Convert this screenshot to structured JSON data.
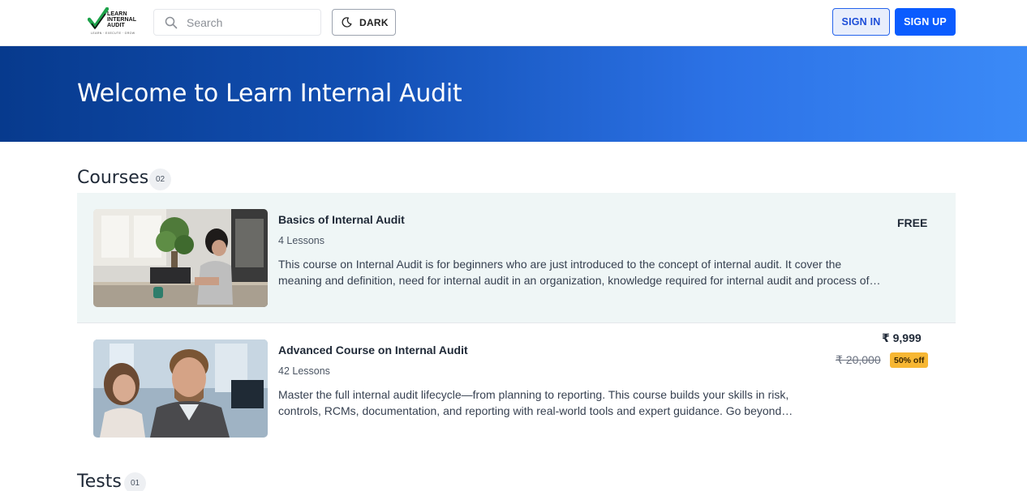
{
  "header": {
    "logo": {
      "line1": "LEARN",
      "line2": "INTERNAL",
      "line3": "AUDIT",
      "tagline": "LEARN · EXECUTE · GROW"
    },
    "search": {
      "placeholder": "Search",
      "value": ""
    },
    "theme_toggle_label": "DARK",
    "signin_label": "SIGN IN",
    "signup_label": "SIGN UP"
  },
  "hero": {
    "title": "Welcome to Learn Internal Audit"
  },
  "courses": {
    "title": "Courses",
    "count": "02",
    "items": [
      {
        "title": "Basics of Internal Audit",
        "lessons": "4 Lessons",
        "description": "This course on Internal Audit is for beginners who are just introduced to the concept of internal audit. It cover the meaning and definition, need for internal audit in an organization, knowledge required for internal audit and process of…",
        "price": "FREE"
      },
      {
        "title": "Advanced Course on Internal Audit",
        "lessons": "42 Lessons",
        "description": "Master the full internal audit lifecycle—from planning to reporting. This course builds your skills in risk, controls, RCMs, documentation, and reporting with real-world tools and expert guidance. Go beyond…",
        "price": "₹ 9,999",
        "original_price": "₹ 20,000",
        "discount": "50% off"
      }
    ]
  },
  "tests": {
    "title": "Tests",
    "count": "01"
  },
  "colors": {
    "primary": "#0b5cff",
    "hero_dark": "#073a8d",
    "hero_light": "#3b8af7",
    "row_highlight": "#eff6f6",
    "discount_badge": "#f7b733"
  }
}
